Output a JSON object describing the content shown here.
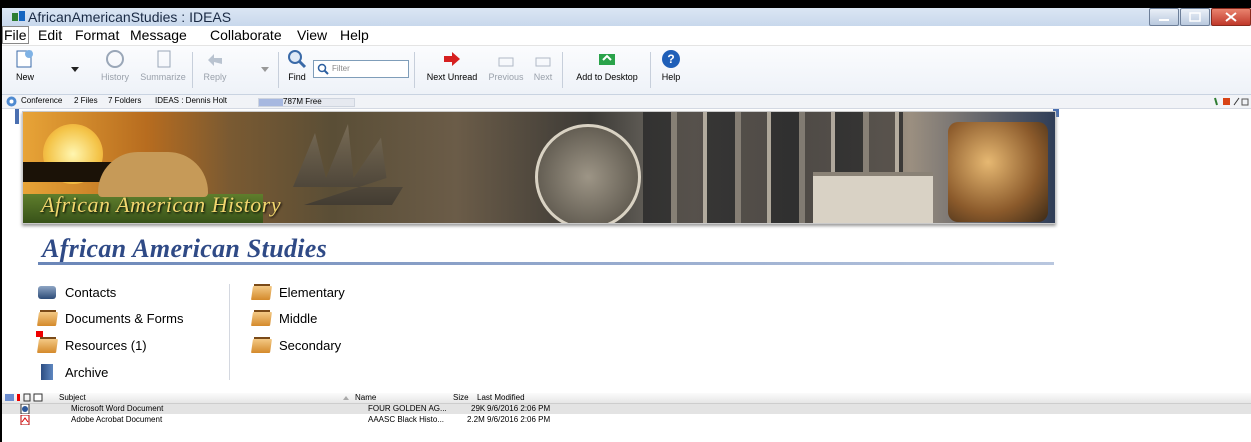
{
  "window": {
    "title": "AfricanAmericanStudies : IDEAS",
    "controls": [
      "minimize",
      "maximize",
      "close"
    ]
  },
  "menu": [
    "File",
    "Edit",
    "Format",
    "Message",
    "Collaborate",
    "View",
    "Help"
  ],
  "toolbar": {
    "new": "New",
    "history": "History",
    "summarize": "Summarize",
    "reply": "Reply",
    "find": "Find",
    "filter_placeholder": "Filter",
    "next_unread": "Next Unread",
    "previous": "Previous",
    "next": "Next",
    "add_to_desktop": "Add to Desktop",
    "help": "Help"
  },
  "status": {
    "location": "Conference",
    "files": "2 Files",
    "folders": "7 Folders",
    "ideas_user": "IDEAS : Dennis Holt",
    "free": "787M Free",
    "free_fraction": 0.25
  },
  "banner": {
    "text": "African American History"
  },
  "section": {
    "title": "African American Studies"
  },
  "links_left": [
    {
      "label": "Contacts",
      "icon": "contacts-icon"
    },
    {
      "label": "Documents & Forms",
      "icon": "folder-icon"
    },
    {
      "label": "Resources (1)",
      "icon": "folder-flag-icon"
    },
    {
      "label": "Archive",
      "icon": "archive-icon"
    }
  ],
  "links_right": [
    {
      "label": "Elementary",
      "icon": "folder-icon"
    },
    {
      "label": "Middle",
      "icon": "folder-icon"
    },
    {
      "label": "Secondary",
      "icon": "folder-icon"
    }
  ],
  "list": {
    "headers": {
      "subject": "Subject",
      "name": "Name",
      "size": "Size",
      "modified": "Last Modified"
    },
    "rows": [
      {
        "subject": "Microsoft Word Document",
        "name": "FOUR GOLDEN AG...",
        "size": "29K",
        "modified": "9/6/2016  2:06 PM",
        "icon": "word-doc-icon"
      },
      {
        "subject": "Adobe Acrobat Document",
        "name": "AAASC Black Histo...",
        "size": "2.2M",
        "modified": "9/6/2016  2:06 PM",
        "icon": "pdf-icon"
      }
    ]
  }
}
